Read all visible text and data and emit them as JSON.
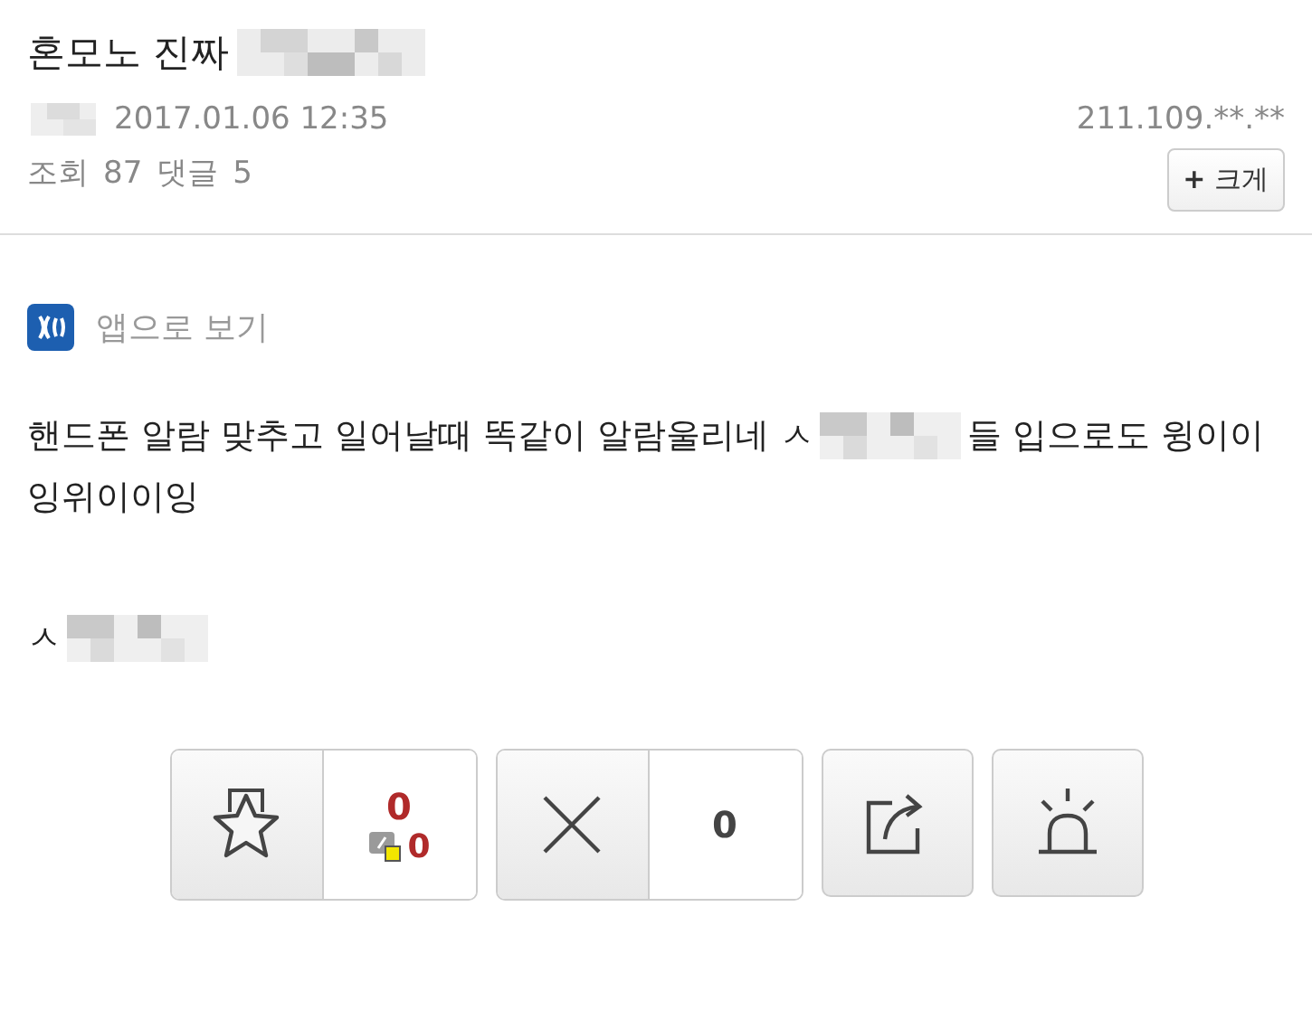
{
  "post": {
    "title": "혼모노 진짜",
    "date": "2017.01.06 12:35",
    "ip": "211.109.**.**",
    "views_label": "조회",
    "views": "87",
    "comments_label": "댓글",
    "comments": "5",
    "zoom_icon": "+",
    "zoom_label": "크게"
  },
  "app_link": {
    "label": "앱으로 보기"
  },
  "body": [
    [
      [
        {
          "kind": "text",
          "text": "핸드폰 알람 맞추고 일어날때 똑같이 알람울리네 ㅅ"
        },
        {
          "kind": "mosaic"
        },
        {
          "kind": "text",
          "text": "들 입으로도 윙이이"
        }
      ],
      [
        {
          "kind": "text",
          "text": "잉위이이잉"
        }
      ]
    ],
    [
      [
        {
          "kind": "text",
          "text": "ㅅ"
        },
        {
          "kind": "mosaic"
        }
      ]
    ]
  ],
  "actions": {
    "recommend": "0",
    "fixed_recommend": "0",
    "not_recommend": "0"
  }
}
